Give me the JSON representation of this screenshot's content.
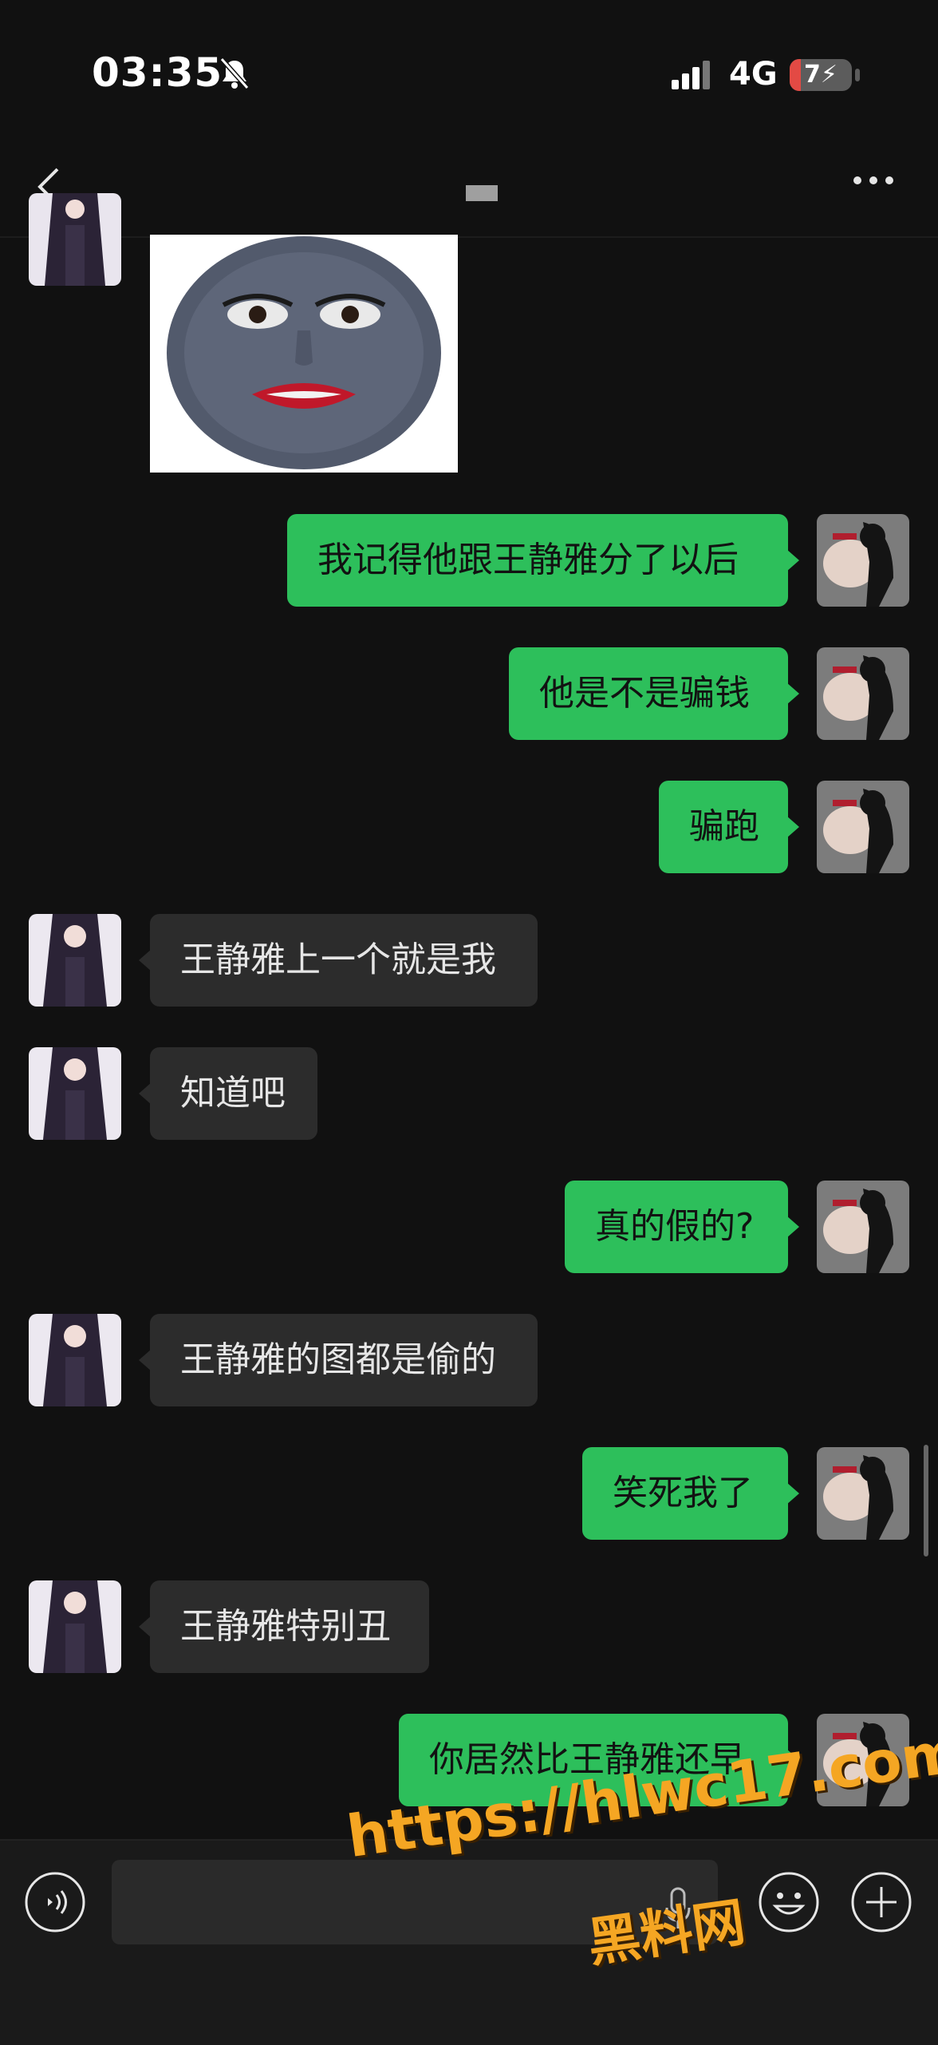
{
  "status_bar": {
    "time": "03:35",
    "network": "4G",
    "battery_text": "7",
    "battery_level": 0.07
  },
  "nav": {
    "back_icon": "chevron-left-icon",
    "more_icon": "ellipsis-icon"
  },
  "messages": [
    {
      "from": "other",
      "type": "sticker"
    },
    {
      "from": "me",
      "text": "我记得他跟王静雅分了以后"
    },
    {
      "from": "me",
      "text": "他是不是骗钱"
    },
    {
      "from": "me",
      "text": "骗跑"
    },
    {
      "from": "other",
      "text": "王静雅上一个就是我"
    },
    {
      "from": "other",
      "text": "知道吧"
    },
    {
      "from": "me",
      "text": "真的假的?"
    },
    {
      "from": "other",
      "text": "王静雅的图都是偷的"
    },
    {
      "from": "me",
      "text": "笑死我了"
    },
    {
      "from": "other",
      "text": "王静雅特别丑"
    },
    {
      "from": "me",
      "text": "你居然比王静雅还早"
    }
  ],
  "input_bar": {
    "voice_icon": "voice-icon",
    "emoji_icon": "emoji-icon",
    "plus_icon": "plus-icon"
  },
  "watermark": {
    "url": "https://hlwc17.com",
    "name": "黑料网"
  },
  "colors": {
    "background": "#111111",
    "outgoing_bubble": "#2dbf5b",
    "incoming_bubble": "#2c2c2c",
    "watermark": "#f5a623"
  }
}
